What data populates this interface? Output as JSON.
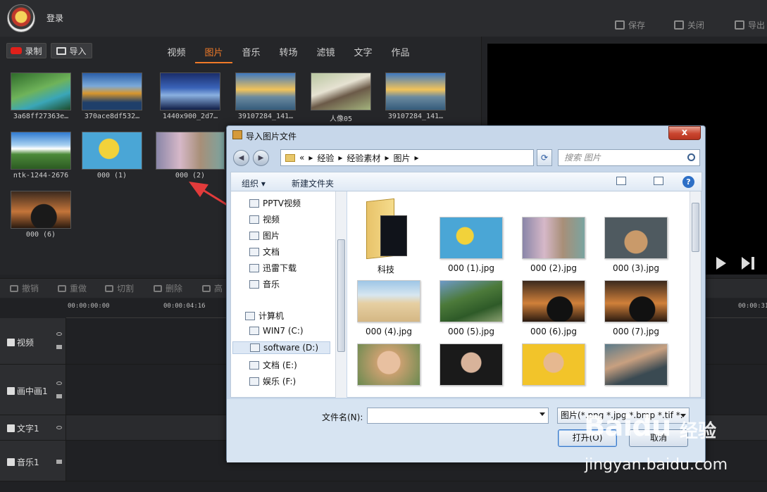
{
  "header": {
    "login": "登录",
    "save": "保存",
    "close": "关闭",
    "export": "导出"
  },
  "media_panel": {
    "record": "录制",
    "import": "导入",
    "tabs": [
      "视频",
      "图片",
      "音乐",
      "转场",
      "滤镜",
      "文字",
      "作品"
    ],
    "active_tab": "图片",
    "items": [
      {
        "label": "3a68ff27363e…"
      },
      {
        "label": "370ace8df532…"
      },
      {
        "label": "1440x900_2d7…"
      },
      {
        "label": "39107284_141…"
      },
      {
        "label": "人像05"
      },
      {
        "label": "39107284_141…"
      },
      {
        "label": "ntk-1244-2676"
      },
      {
        "label": "000 (1)"
      },
      {
        "label": "000 (2)"
      },
      {
        "label": "000 (6)"
      }
    ]
  },
  "edit_toolbar": {
    "undo": "撤销",
    "redo": "重做",
    "cut": "切割",
    "delete": "删除",
    "more": "高"
  },
  "timeline": {
    "times": [
      "00:00:00:00",
      "00:00:04:16",
      "00:00:31"
    ],
    "tracks": [
      "视频",
      "画中画1",
      "文字1",
      "音乐1"
    ]
  },
  "dialog": {
    "title": "导入图片文件",
    "close_symbol": "x",
    "address": [
      "«",
      "经验",
      "经验素材",
      "图片"
    ],
    "search_placeholder": "搜索 图片",
    "organize": "组织 ▾",
    "new_folder": "新建文件夹",
    "help": "?",
    "nav_items": [
      "PPTV视频",
      "视频",
      "图片",
      "文档",
      "迅雷下载",
      "音乐"
    ],
    "computer": "计算机",
    "drives": [
      "WIN7 (C:)",
      "software (D:)",
      "文档 (E:)",
      "娱乐 (F:)"
    ],
    "selected_drive": "software (D:)",
    "files": [
      "科技",
      "000 (1).jpg",
      "000 (2).jpg",
      "000 (3).jpg",
      "000 (4).jpg",
      "000 (5).jpg",
      "000 (6).jpg",
      "000 (7).jpg",
      "",
      "",
      "",
      ""
    ],
    "filename_label": "文件名(N):",
    "filename_value": "",
    "filetype": "图片(*.png *.jpg *.bmp *.tif *.",
    "open_button": "打开(O)",
    "cancel_button": "取消"
  },
  "watermark": {
    "brand": "Baidu",
    "jingyan": "经验",
    "url": "jingyan.baidu.com"
  }
}
